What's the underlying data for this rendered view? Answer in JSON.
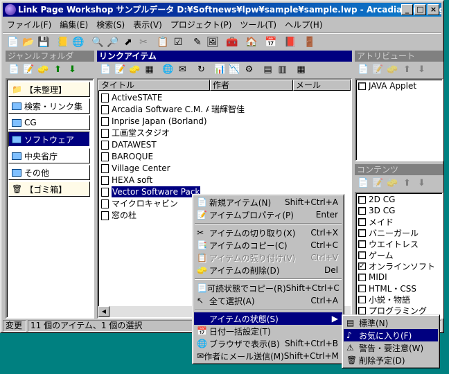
{
  "window": {
    "title": "Link Page Workshop サンプルデータ D:¥Softnews¥lpw¥sample¥sample.lwp - Arcadia Link Pag..."
  },
  "menubar": [
    "ファイル(F)",
    "編集(E)",
    "検索(S)",
    "表示(V)",
    "プロジェクト(P)",
    "ツール(T)",
    "ヘルプ(H)"
  ],
  "genre": {
    "header": "ジャンルフォルダ",
    "items": [
      "【未整理】",
      "検索・リンク集",
      "CG",
      "ソフトウェア",
      "中央省庁",
      "その他",
      "【ゴミ箱】"
    ]
  },
  "links": {
    "header": "リンクアイテム",
    "columns": [
      "タイトル",
      "作者",
      "メール"
    ],
    "rows": [
      {
        "title": "ActiveSTATE",
        "author": ""
      },
      {
        "title": "Arcadia Software C.M. Ap...",
        "author": "瑞輝智佳"
      },
      {
        "title": "Inprise Japan (Borland)",
        "author": ""
      },
      {
        "title": "工画堂スタジオ",
        "author": ""
      },
      {
        "title": "DATAWEST",
        "author": ""
      },
      {
        "title": "BAROQUE",
        "author": ""
      },
      {
        "title": "Village Center",
        "author": ""
      },
      {
        "title": "HEXA soft",
        "author": ""
      },
      {
        "title": "Vector Software Pack",
        "author": ""
      },
      {
        "title": "マイクロキャビン",
        "author": ""
      },
      {
        "title": "窓の杜",
        "author": ""
      }
    ]
  },
  "attribute": {
    "header": "アトリビュート",
    "items": [
      {
        "label": "JAVA Applet",
        "checked": false
      }
    ]
  },
  "contents": {
    "header": "コンテンツ",
    "items": [
      {
        "label": "2D CG",
        "checked": false
      },
      {
        "label": "3D CG",
        "checked": false
      },
      {
        "label": "メイド",
        "checked": false
      },
      {
        "label": "バニーガール",
        "checked": false
      },
      {
        "label": "ウエイトレス",
        "checked": false
      },
      {
        "label": "ゲーム",
        "checked": false
      },
      {
        "label": "オンラインソフト",
        "checked": true
      },
      {
        "label": "MIDI",
        "checked": false
      },
      {
        "label": "HTML・CSS",
        "checked": false
      },
      {
        "label": "小説・物語",
        "checked": false
      },
      {
        "label": "プログラミング",
        "checked": false
      }
    ]
  },
  "status": {
    "mode": "変更",
    "text": "11 個のアイテム、1 個の選択"
  },
  "context_menu": [
    {
      "label": "新規アイテム(N)",
      "shortcut": "Shift+Ctrl+A",
      "icon": "new-item-icon"
    },
    {
      "label": "アイテムプロパティ(P)",
      "shortcut": "Enter",
      "icon": "properties-icon"
    },
    {
      "sep": true
    },
    {
      "label": "アイテムの切り取り(X)",
      "shortcut": "Ctrl+X",
      "icon": "cut-icon"
    },
    {
      "label": "アイテムのコピー(C)",
      "shortcut": "Ctrl+C",
      "icon": "copy-icon"
    },
    {
      "label": "アイテムの張り付け(V)",
      "shortcut": "Ctrl+V",
      "icon": "paste-icon",
      "disabled": true
    },
    {
      "label": "アイテムの削除(D)",
      "shortcut": "Del",
      "icon": "delete-icon"
    },
    {
      "sep": true
    },
    {
      "label": "可読状態でコピー(R)",
      "shortcut": "Shift+Ctrl+C",
      "icon": "readable-copy-icon"
    },
    {
      "label": "全て選択(A)",
      "shortcut": "Ctrl+A",
      "icon": "select-all-icon"
    },
    {
      "sep": true
    },
    {
      "label": "アイテムの状態(S)",
      "shortcut": "",
      "icon": "",
      "submenu": true,
      "highlighted": true
    },
    {
      "label": "日付一括設定(T)",
      "shortcut": "",
      "icon": "calendar-icon"
    },
    {
      "label": "ブラウザで表示(B)",
      "shortcut": "Shift+Ctrl+B",
      "icon": "browser-icon"
    },
    {
      "label": "作者にメール送信(M)",
      "shortcut": "Shift+Ctrl+M",
      "icon": "mail-icon"
    }
  ],
  "submenu": [
    {
      "label": "標準(N)",
      "icon": "standard-icon"
    },
    {
      "label": "お気に入り(F)",
      "icon": "favorite-icon",
      "highlighted": true
    },
    {
      "label": "警告・要注意(W)",
      "icon": "warning-icon"
    },
    {
      "label": "削除予定(D)",
      "icon": "delete-scheduled-icon"
    }
  ]
}
